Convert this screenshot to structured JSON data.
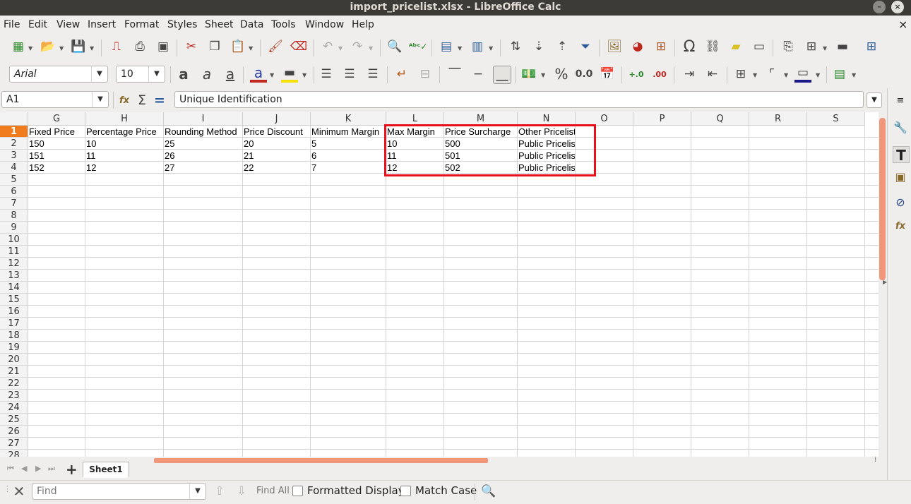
{
  "window": {
    "title": "import_pricelist.xlsx - LibreOffice Calc",
    "minimize_glyph": "–",
    "close_glyph": "×",
    "doc_close_glyph": "×"
  },
  "menu": [
    "File",
    "Edit",
    "View",
    "Insert",
    "Format",
    "Styles",
    "Sheet",
    "Data",
    "Tools",
    "Window",
    "Help"
  ],
  "formatting": {
    "font_name": "Arial",
    "font_size": "10",
    "percent_label": "%",
    "decimal_label": "0.0",
    "increase_decimal": "+.0",
    "decrease_decimal": ".00"
  },
  "formula_bar": {
    "name_box": "A1",
    "content": "Unique Identification",
    "sum_glyph": "Σ",
    "equals_glyph": "="
  },
  "columns": [
    "G",
    "H",
    "I",
    "J",
    "K",
    "L",
    "M",
    "N",
    "O",
    "P",
    "Q",
    "R",
    "S"
  ],
  "rows": [
    "1",
    "2",
    "3",
    "4",
    "5",
    "6",
    "7",
    "8",
    "9",
    "10",
    "11",
    "12",
    "13",
    "14",
    "15",
    "16",
    "17",
    "18",
    "19",
    "20",
    "21",
    "22",
    "23",
    "24",
    "25",
    "26",
    "27",
    "28"
  ],
  "cells": {
    "headers": [
      "Fixed Price",
      "Percentage Price",
      "Rounding Method",
      "Price Discount",
      "Minimum Margin",
      "Max Margin",
      "Price Surcharge",
      "Other Pricelist"
    ],
    "data": [
      [
        "150",
        "10",
        "25",
        "20",
        "5",
        "10",
        "500",
        "Public Pricelist"
      ],
      [
        "151",
        "11",
        "26",
        "21",
        "6",
        "11",
        "501",
        "Public Pricelist"
      ],
      [
        "152",
        "12",
        "27",
        "22",
        "7",
        "12",
        "502",
        "Public Pricelist"
      ]
    ]
  },
  "highlight": {
    "color": "#e8111b",
    "columns": "L:N",
    "rows": "1:4"
  },
  "sheet_tabs": [
    "Sheet1"
  ],
  "add_sheet_glyph": "+",
  "find": {
    "placeholder": "Find",
    "find_all": "Find All",
    "formatted_display": "Formatted Display",
    "match_case": "Match Case"
  },
  "colors": {
    "accent": "#f07c1d",
    "scroll_thumb": "#f0967a",
    "titlebar": "#3c3b37"
  }
}
